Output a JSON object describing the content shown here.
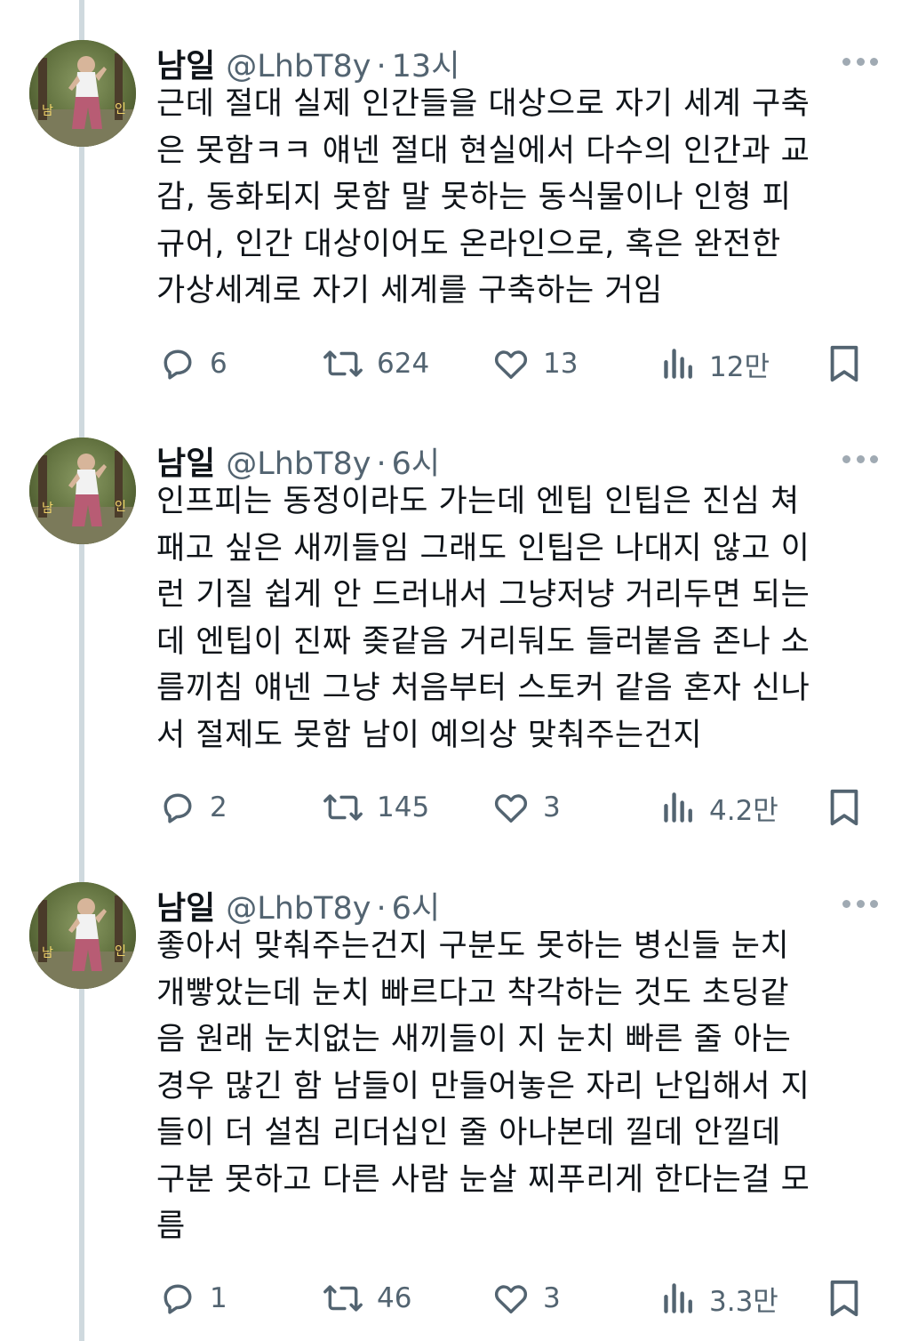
{
  "tweets": [
    {
      "name": "남일",
      "handle": "@LhbT8y",
      "dot": "·",
      "time": "13시",
      "lines": [
        "근데 절대 실제 인간들을 대상으로 자기 세계 구축",
        "은 못함ㅋㅋ 얘넨 절대 현실에서 다수의 인간과 교",
        "감, 동화되지 못함 말 못하는 동식물이나 인형 피",
        "규어, 인간 대상이어도 온라인으로, 혹은 완전한",
        "가상세계로 자기 세계를 구축하는 거임"
      ],
      "replies": "6",
      "retweets": "624",
      "likes": "13",
      "views": "12만"
    },
    {
      "name": "남일",
      "handle": "@LhbT8y",
      "dot": "·",
      "time": "6시",
      "lines": [
        "인프피는 동정이라도 가는데 엔팁 인팁은 진심 쳐",
        "패고 싶은 새끼들임 그래도 인팁은 나대지 않고 이",
        "런 기질 쉽게 안 드러내서 그냥저냥 거리두면 되는",
        "데 엔팁이 진짜 좆같음 거리둬도 들러붙음 존나 소",
        "름끼침 얘넨 그냥 처음부터 스토커 같음 혼자 신나",
        "서 절제도 못함 남이 예의상 맞춰주는건지"
      ],
      "replies": "2",
      "retweets": "145",
      "likes": "3",
      "views": "4.2만"
    },
    {
      "name": "남일",
      "handle": "@LhbT8y",
      "dot": "·",
      "time": "6시",
      "lines": [
        "좋아서 맞춰주는건지 구분도 못하는 병신들 눈치",
        "개빻았는데 눈치 빠르다고 착각하는 것도 초딩같",
        "음 원래 눈치없는 새끼들이 지 눈치 빠른 줄 아는",
        "경우 많긴 함 남들이 만들어놓은 자리 난입해서 지",
        "들이 더 설침 리더십인 줄 아나본데 낄데 안낄데",
        "구분 못하고 다른 사람 눈살 찌푸리게 한다는걸 모",
        "름"
      ],
      "replies": "1",
      "retweets": "46",
      "likes": "3",
      "views": "3.3만"
    }
  ],
  "icons": {
    "reply": "reply-icon",
    "retweet": "retweet-icon",
    "like": "heart-icon",
    "views": "views-icon",
    "bookmark": "bookmark-icon",
    "more": "more-icon"
  },
  "colors": {
    "text": "#0f1419",
    "secondary": "#536471",
    "thread_line": "#cfd9de"
  }
}
